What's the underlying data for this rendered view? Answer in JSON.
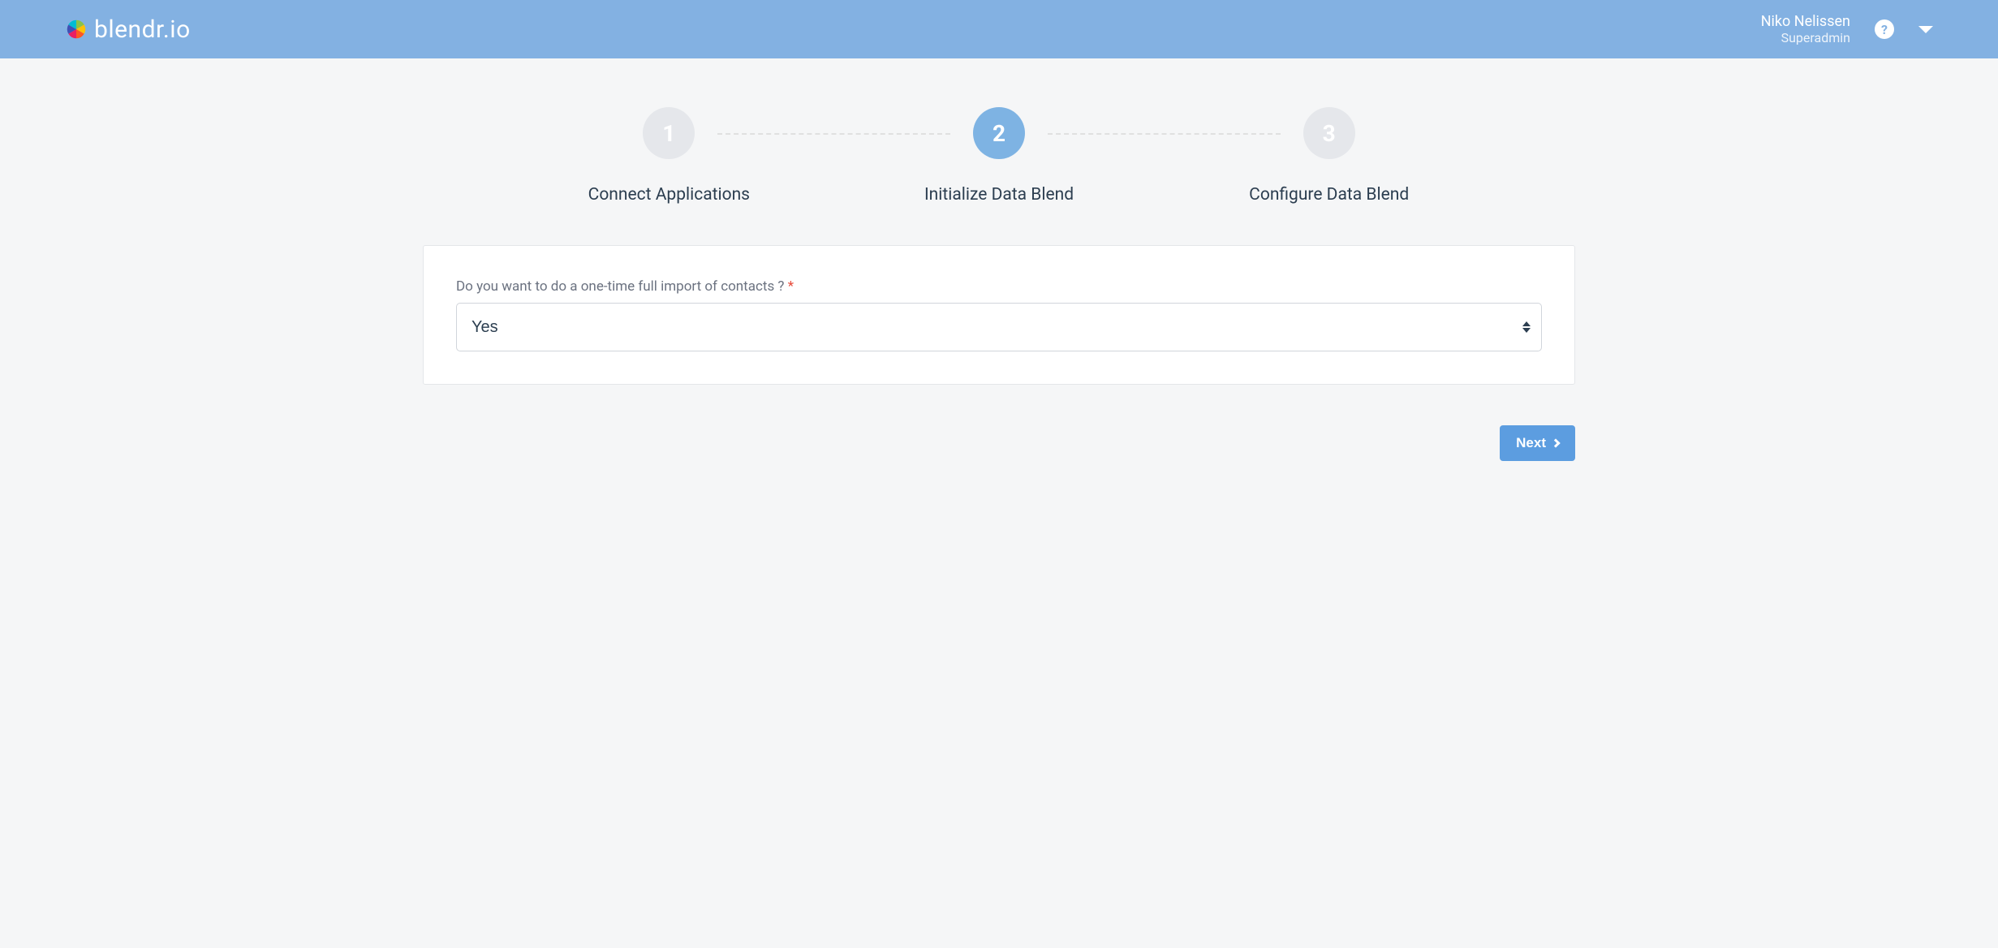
{
  "header": {
    "logo_text": "blendr.io",
    "user_name": "Niko Nelissen",
    "user_role": "Superadmin"
  },
  "stepper": {
    "steps": [
      {
        "number": "1",
        "label": "Connect Applications",
        "state": "inactive"
      },
      {
        "number": "2",
        "label": "Initialize Data Blend",
        "state": "active"
      },
      {
        "number": "3",
        "label": "Configure Data Blend",
        "state": "inactive"
      }
    ]
  },
  "form": {
    "question_label": "Do you want to do a one-time full import of contacts ?",
    "required_marker": "*",
    "selected_value": "Yes"
  },
  "actions": {
    "next_label": "Next"
  }
}
